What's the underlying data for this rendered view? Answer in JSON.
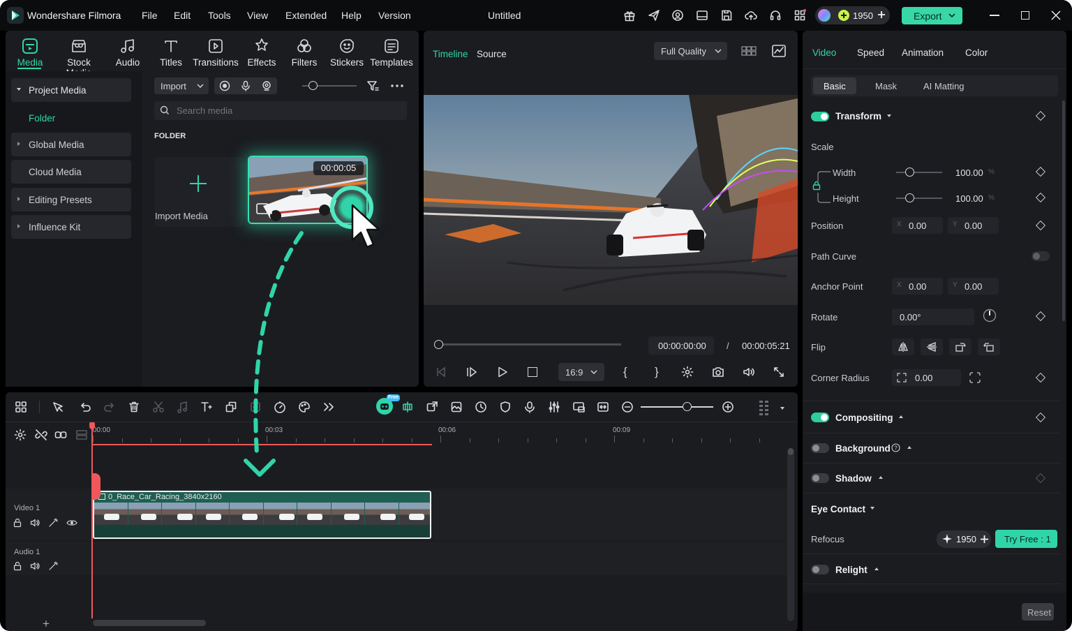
{
  "app": {
    "name": "Wondershare Filmora",
    "document_title": "Untitled"
  },
  "menu": [
    "File",
    "Edit",
    "Tools",
    "View",
    "Extended",
    "Help",
    "Version"
  ],
  "title_right": {
    "credits": "1950",
    "export": "Export"
  },
  "toolbar": [
    {
      "label": "Media",
      "icon": "media-icon",
      "active": true
    },
    {
      "label": "Stock Media",
      "icon": "stock-media-icon"
    },
    {
      "label": "Audio",
      "icon": "audio-icon"
    },
    {
      "label": "Titles",
      "icon": "titles-icon"
    },
    {
      "label": "Transitions",
      "icon": "transitions-icon"
    },
    {
      "label": "Effects",
      "icon": "effects-icon"
    },
    {
      "label": "Filters",
      "icon": "filters-icon"
    },
    {
      "label": "Stickers",
      "icon": "stickers-icon"
    },
    {
      "label": "Templates",
      "icon": "templates-icon"
    }
  ],
  "sidebar": {
    "items": [
      "Project Media",
      "Folder",
      "Global Media",
      "Cloud Media",
      "Editing Presets",
      "Influence Kit"
    ]
  },
  "media": {
    "import_label": "Import",
    "search_placeholder": "Search media",
    "folder_label": "FOLDER",
    "import_media": "Import Media",
    "clip_duration": "00:00:05"
  },
  "player": {
    "tabs": [
      "Timeline",
      "Source"
    ],
    "quality": "Full Quality",
    "current_time": "00:00:00:00",
    "separator": "/",
    "total_time": "00:00:05:21",
    "aspect": "16:9",
    "progress": 0.0
  },
  "inspector": {
    "tabs": [
      "Video",
      "Speed",
      "Animation",
      "Color"
    ],
    "subtabs": [
      "Basic",
      "Mask",
      "AI Matting"
    ],
    "transform": "Transform",
    "scale": "Scale",
    "width_label": "Width",
    "width_value": "100.00",
    "height_label": "Height",
    "height_value": "100.00",
    "percent": "%",
    "position": "Position",
    "pos_x": "0.00",
    "pos_y": "0.00",
    "x_prefix": "X",
    "y_prefix": "Y",
    "path_curve": "Path Curve",
    "anchor": "Anchor Point",
    "anchor_x": "0.00",
    "anchor_y": "0.00",
    "rotate": "Rotate",
    "rotate_value": "0.00°",
    "flip": "Flip",
    "corner_radius": "Corner Radius",
    "corner_value": "0.00",
    "compositing": "Compositing",
    "background": "Background",
    "shadow": "Shadow",
    "eye_contact": "Eye Contact",
    "refocus": "Refocus",
    "refocus_credits": "1950",
    "try_free": "Try Free : 1",
    "relight": "Relight",
    "reset": "Reset"
  },
  "timeline": {
    "ruler": [
      "00:00",
      "00:03",
      "00:06",
      "00:09"
    ],
    "video_track": "Video 1",
    "audio_track": "Audio 1",
    "clip_name": "0_Race_Car_Racing_3840x2160",
    "free_badge": "Free"
  },
  "colors": {
    "accent": "#2fd5a8",
    "export_bg": "#37d8a6",
    "playhead": "#f0575b"
  }
}
